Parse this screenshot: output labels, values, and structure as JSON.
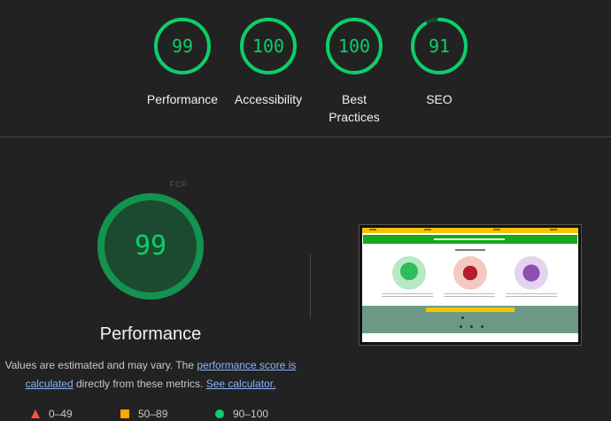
{
  "summary_gauges": [
    {
      "score": "99",
      "label_lines": [
        "Performance"
      ],
      "fraction": 0.99
    },
    {
      "score": "100",
      "label_lines": [
        "Accessibility"
      ],
      "fraction": 1.0
    },
    {
      "score": "100",
      "label_lines": [
        "Best",
        "Practices"
      ],
      "fraction": 1.0
    },
    {
      "score": "91",
      "label_lines": [
        "SEO"
      ],
      "fraction": 0.91
    }
  ],
  "performance": {
    "score": "99",
    "fraction": 0.99,
    "title": "Performance",
    "fcp_label": "FCP",
    "desc_prefix": "Values are estimated and may vary. The ",
    "desc_link1": "performance score is calculated",
    "desc_middle": " directly from these metrics. ",
    "desc_link2": "See calculator."
  },
  "legend": [
    {
      "range": "0–49",
      "shape": "triangle",
      "color": "#ff4e42"
    },
    {
      "range": "50–89",
      "shape": "square",
      "color": "#ffa400"
    },
    {
      "range": "90–100",
      "shape": "circle",
      "color": "#0cce6b"
    }
  ],
  "colors": {
    "pass": "#0cce6b",
    "pass_bg": "#1c4a30",
    "link": "#8ab4f8",
    "background": "#222222"
  }
}
